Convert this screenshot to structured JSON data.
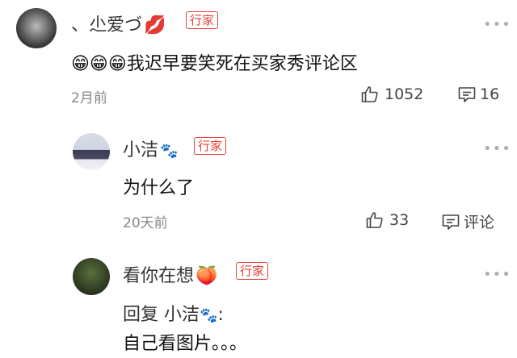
{
  "comment": {
    "username": "、尐爱づ",
    "name_emoji": "💋",
    "badge": "行家",
    "emojis": "😁😁😁",
    "text": "我迟早要笑死在买家秀评论区",
    "time": "2月前",
    "likes": "1052",
    "replies_count": "16",
    "more": "•••"
  },
  "replies": [
    {
      "username": "小洁",
      "name_emoji": "🐾",
      "badge": "行家",
      "text": "为什么了",
      "time": "20天前",
      "likes": "33",
      "reply_label": "评论",
      "more": "•••"
    },
    {
      "username": "看你在想",
      "name_emoji": "🍑",
      "badge": "行家",
      "reply_prefix": "回复",
      "reply_to": "小洁",
      "reply_to_emoji": "🐾",
      "reply_colon": ":",
      "text": "自己看图片。。。",
      "more": "•••"
    }
  ],
  "colors": {
    "badge": "#e8423a",
    "meta": "#888888"
  }
}
